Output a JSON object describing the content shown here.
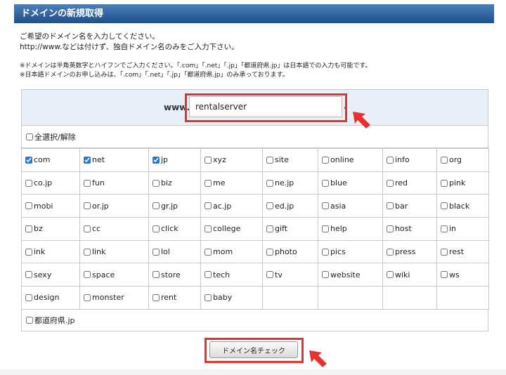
{
  "header": {
    "title": "ドメインの新規取得"
  },
  "intro": {
    "line1": "ご希望のドメイン名を入力してください。",
    "line2": "http://www.などは付けず、独自ドメイン名のみをご入力下さい。"
  },
  "notes": {
    "line1": "※ドメインは半角英数字とハイフンでご入力ください。「.com」「.net」「.jp」「都道府県.jp」は日本語での入力も可能です。",
    "line2": "※日本語ドメインのお申し込みは、「.com」「.net」「.jp」「都道府県.jp」のみ承っております。"
  },
  "domain_input": {
    "prefix": "www.",
    "value": "rentalserver",
    "suffix": "."
  },
  "select_all": {
    "label": "全選択/解除",
    "checked": false
  },
  "tlds": [
    [
      {
        "label": "com",
        "checked": true
      },
      {
        "label": "net",
        "checked": true
      },
      {
        "label": "jp",
        "checked": true
      },
      {
        "label": "xyz",
        "checked": false
      },
      {
        "label": "site",
        "checked": false
      },
      {
        "label": "online",
        "checked": false
      },
      {
        "label": "info",
        "checked": false
      },
      {
        "label": "org",
        "checked": false
      }
    ],
    [
      {
        "label": "co.jp",
        "checked": false
      },
      {
        "label": "fun",
        "checked": false
      },
      {
        "label": "biz",
        "checked": false
      },
      {
        "label": "me",
        "checked": false
      },
      {
        "label": "ne.jp",
        "checked": false
      },
      {
        "label": "blue",
        "checked": false
      },
      {
        "label": "red",
        "checked": false
      },
      {
        "label": "pink",
        "checked": false
      }
    ],
    [
      {
        "label": "mobi",
        "checked": false
      },
      {
        "label": "or.jp",
        "checked": false
      },
      {
        "label": "gr.jp",
        "checked": false
      },
      {
        "label": "ac.jp",
        "checked": false
      },
      {
        "label": "ed.jp",
        "checked": false
      },
      {
        "label": "asia",
        "checked": false
      },
      {
        "label": "bar",
        "checked": false
      },
      {
        "label": "black",
        "checked": false
      }
    ],
    [
      {
        "label": "bz",
        "checked": false
      },
      {
        "label": "cc",
        "checked": false
      },
      {
        "label": "click",
        "checked": false
      },
      {
        "label": "college",
        "checked": false
      },
      {
        "label": "gift",
        "checked": false
      },
      {
        "label": "help",
        "checked": false
      },
      {
        "label": "host",
        "checked": false
      },
      {
        "label": "in",
        "checked": false
      }
    ],
    [
      {
        "label": "ink",
        "checked": false
      },
      {
        "label": "link",
        "checked": false
      },
      {
        "label": "lol",
        "checked": false
      },
      {
        "label": "mom",
        "checked": false
      },
      {
        "label": "photo",
        "checked": false
      },
      {
        "label": "pics",
        "checked": false
      },
      {
        "label": "press",
        "checked": false
      },
      {
        "label": "rest",
        "checked": false
      }
    ],
    [
      {
        "label": "sexy",
        "checked": false
      },
      {
        "label": "space",
        "checked": false
      },
      {
        "label": "store",
        "checked": false
      },
      {
        "label": "tech",
        "checked": false
      },
      {
        "label": "tv",
        "checked": false
      },
      {
        "label": "website",
        "checked": false
      },
      {
        "label": "wiki",
        "checked": false
      },
      {
        "label": "ws",
        "checked": false
      }
    ],
    [
      {
        "label": "design",
        "checked": false
      },
      {
        "label": "monster",
        "checked": false
      },
      {
        "label": "rent",
        "checked": false
      },
      {
        "label": "baby",
        "checked": false
      }
    ]
  ],
  "prefecture": {
    "label": "都道府県.jp",
    "checked": false
  },
  "check_button": {
    "label": "ドメイン名チェック"
  },
  "colors": {
    "header_top": "#4d7fb8",
    "header_bottom": "#1f4f8c",
    "highlight": "#e8302f",
    "input_row_bg": "#e8eff8"
  }
}
